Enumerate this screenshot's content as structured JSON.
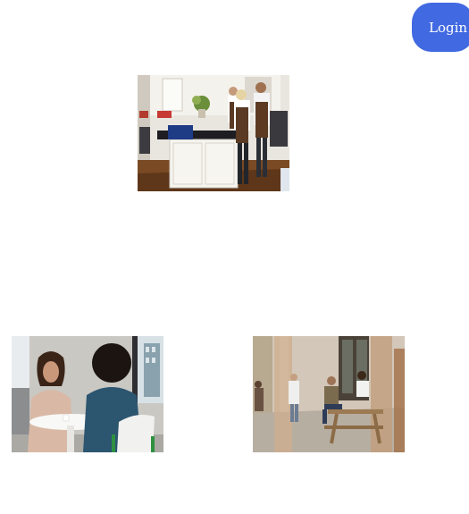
{
  "header": {
    "login_label": "Login"
  },
  "images": {
    "kitchen": {
      "icon": "photo-chefs-in-kitchen"
    },
    "meeting": {
      "icon": "photo-two-women-at-table"
    },
    "plaza": {
      "icon": "photo-people-at-picnic-table"
    }
  },
  "colors": {
    "login_button": "#4169e1",
    "page_background": "#ffffff"
  }
}
